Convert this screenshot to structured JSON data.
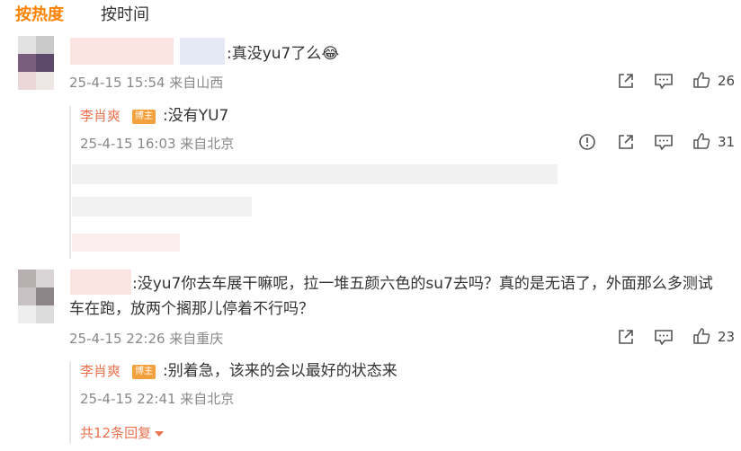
{
  "tabs": {
    "hot": "按热度",
    "time": "按时间"
  },
  "comments": [
    {
      "text": ":真没yu7了么",
      "emoji": "😂",
      "time": "25-4-15 15:54 来自山西",
      "likes": "26",
      "reply": {
        "author": "李肖爽",
        "badge": "博主",
        "text": ":没有YU7",
        "time": "25-4-15 16:03 来自北京",
        "likes": "31"
      }
    },
    {
      "text_line1": ":没yu7你去车展干嘛呢，拉一堆五颜六色的su7去吗？真的是无语了，外面那么多测试",
      "text_line2": "车在跑，放两个搁那儿停着不行吗？",
      "time": "25-4-15 22:26 来自重庆",
      "likes": "23",
      "reply": {
        "author": "李肖爽",
        "badge": "博主",
        "text": ":别着急，该来的会以最好的状态来",
        "time": "25-4-15 22:41 来自北京"
      },
      "more_replies": "共12条回复"
    }
  ]
}
